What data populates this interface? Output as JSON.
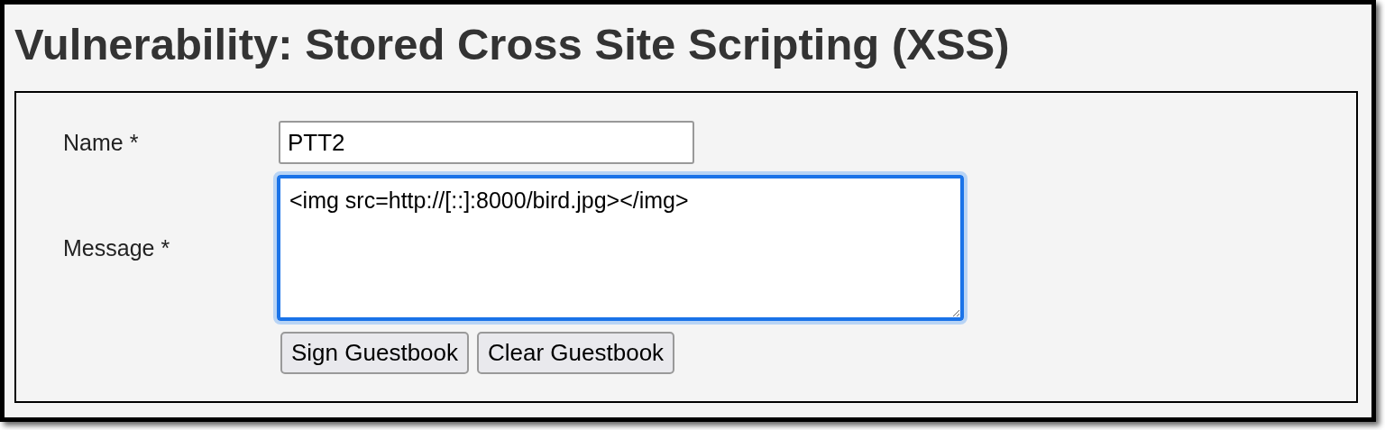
{
  "heading": "Vulnerability: Stored Cross Site Scripting (XSS)",
  "form": {
    "fields": [
      {
        "kind": "input",
        "label": "Name *",
        "value": "PTT2",
        "focused": false
      },
      {
        "kind": "textarea",
        "label": "Message *",
        "value": "<img src=http://[::]:8000/bird.jpg></img>",
        "focused": true
      }
    ],
    "buttons": [
      "Sign Guestbook",
      "Clear Guestbook"
    ]
  }
}
